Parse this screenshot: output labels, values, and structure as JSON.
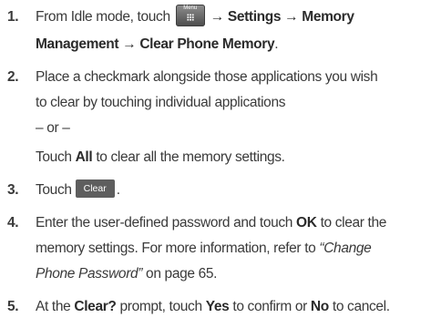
{
  "steps": [
    {
      "number": "1.",
      "part1": "From Idle mode, touch",
      "menu_icon_label": "Menu",
      "arrow1": "→",
      "settings": "Settings",
      "arrow2": "→",
      "memory": "Memory",
      "management": "Management",
      "arrow3": "→",
      "clear_phone_memory": "Clear Phone Memory",
      "end": "."
    },
    {
      "number": "2.",
      "line1": "Place a checkmark alongside those applications you wish",
      "line2": "to clear by touching individual applications",
      "or_text": "– or –",
      "touch": "Touch",
      "all": "All",
      "rest": "to clear all the memory settings."
    },
    {
      "number": "3.",
      "touch": "Touch",
      "button_label": "Clear",
      "end": "."
    },
    {
      "number": "4.",
      "line1_a": "Enter the user-defined password and touch",
      "ok": "OK",
      "line1_b": "to clear the",
      "line2_a": "memory settings. For more information, refer to",
      "ref_a": "“Change",
      "ref_b": "Phone Password”",
      "line3_b": " on page 65."
    },
    {
      "number": "5.",
      "part1": "At the",
      "clear_prompt": "Clear?",
      "part2": "prompt, touch",
      "yes": "Yes",
      "part3": "to confirm or",
      "no": "No",
      "part4": "to cancel."
    }
  ]
}
